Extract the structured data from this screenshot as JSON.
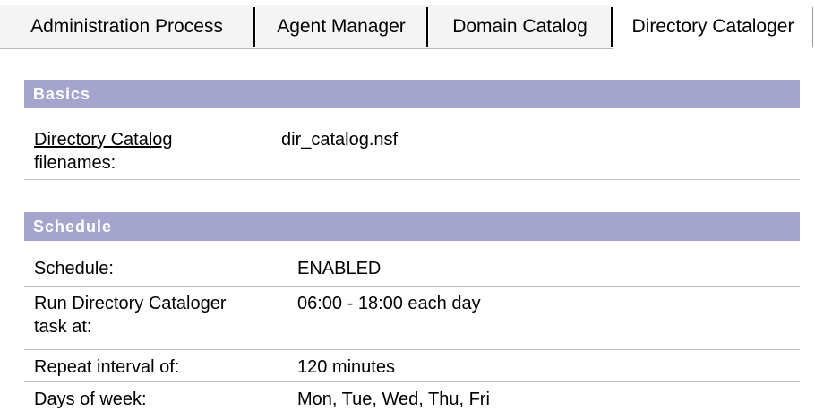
{
  "tabs": [
    {
      "label": "Administration Process",
      "active": false
    },
    {
      "label": "Agent Manager",
      "active": false
    },
    {
      "label": "Domain Catalog",
      "active": false
    },
    {
      "label": "Directory Cataloger",
      "active": true
    }
  ],
  "basics": {
    "header": "Basics",
    "directory_catalog_label_link": "Directory Catalog",
    "directory_catalog_label_rest": "filenames:",
    "directory_catalog_value": "dir_catalog.nsf"
  },
  "schedule": {
    "header": "Schedule",
    "rows": [
      {
        "label": "Schedule:",
        "value": "ENABLED"
      },
      {
        "label_line1": "Run Directory Cataloger",
        "label_line2": "task at:",
        "value": "06:00 - 18:00 each day"
      },
      {
        "label": "Repeat interval of:",
        "value": "120 minutes"
      },
      {
        "label": "Days of week:",
        "value": "Mon, Tue, Wed, Thu, Fri"
      }
    ]
  },
  "colors": {
    "section_header_bg": "#a4a4cc",
    "section_header_text": "#ffffff",
    "row_divider": "#c0c0c0"
  }
}
